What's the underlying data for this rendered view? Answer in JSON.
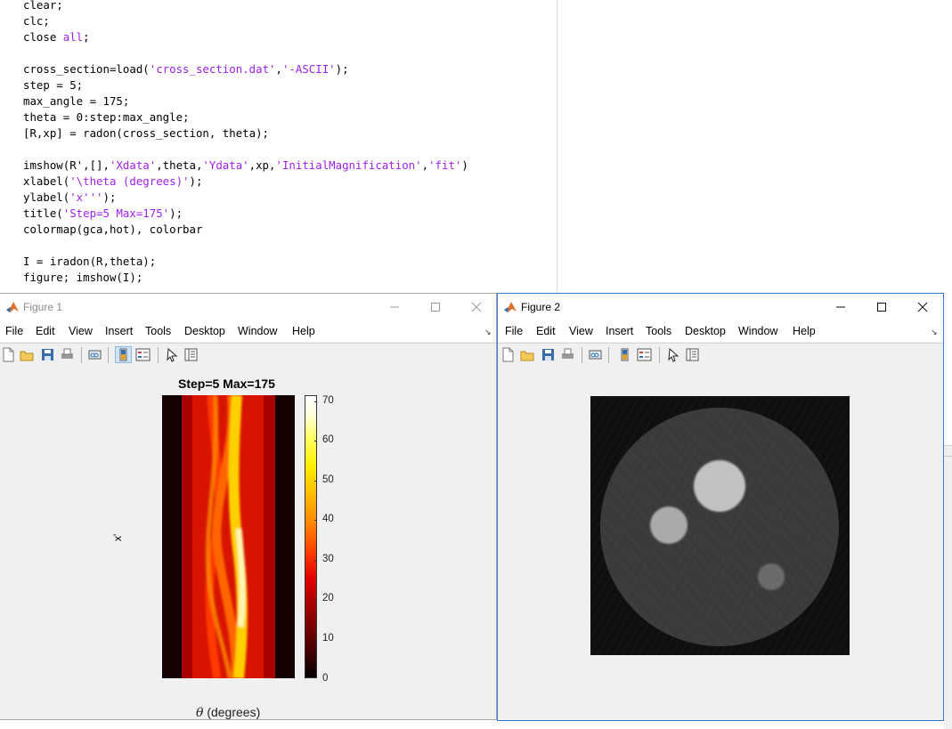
{
  "editor": {
    "lines": [
      {
        "parts": [
          {
            "t": "clear;"
          }
        ]
      },
      {
        "parts": [
          {
            "t": "clc;"
          }
        ]
      },
      {
        "parts": [
          {
            "t": "close "
          },
          {
            "t": "all",
            "s": true
          },
          {
            "t": ";"
          }
        ]
      },
      {
        "parts": [
          {
            "t": ""
          }
        ]
      },
      {
        "parts": [
          {
            "t": "cross_section=load("
          },
          {
            "t": "'cross_section.dat'",
            "s": true
          },
          {
            "t": ","
          },
          {
            "t": "'-ASCII'",
            "s": true
          },
          {
            "t": ");"
          }
        ]
      },
      {
        "parts": [
          {
            "t": "step = 5;"
          }
        ]
      },
      {
        "parts": [
          {
            "t": "max_angle = 175;"
          }
        ]
      },
      {
        "parts": [
          {
            "t": "theta = 0:step:max_angle;"
          }
        ]
      },
      {
        "parts": [
          {
            "t": "[R,xp] = radon(cross_section, theta);"
          }
        ]
      },
      {
        "parts": [
          {
            "t": ""
          }
        ]
      },
      {
        "parts": [
          {
            "t": "imshow(R',[],"
          },
          {
            "t": "'Xdata'",
            "s": true
          },
          {
            "t": ",theta,"
          },
          {
            "t": "'Ydata'",
            "s": true
          },
          {
            "t": ",xp,"
          },
          {
            "t": "'InitialMagnification'",
            "s": true
          },
          {
            "t": ","
          },
          {
            "t": "'fit'",
            "s": true
          },
          {
            "t": ")"
          }
        ]
      },
      {
        "parts": [
          {
            "t": "xlabel("
          },
          {
            "t": "'\\theta (degrees)'",
            "s": true
          },
          {
            "t": ");"
          }
        ]
      },
      {
        "parts": [
          {
            "t": "ylabel("
          },
          {
            "t": "'x'''",
            "s": true
          },
          {
            "t": ");"
          }
        ]
      },
      {
        "parts": [
          {
            "t": "title("
          },
          {
            "t": "'Step=5 Max=175'",
            "s": true
          },
          {
            "t": ");"
          }
        ]
      },
      {
        "parts": [
          {
            "t": "colormap(gca,hot), colorbar"
          }
        ]
      },
      {
        "parts": [
          {
            "t": ""
          }
        ]
      },
      {
        "parts": [
          {
            "t": "I = iradon(R,theta);"
          }
        ]
      },
      {
        "parts": [
          {
            "t": "figure; imshow(I);"
          }
        ]
      }
    ],
    "string_color": "#a020f0"
  },
  "figure1": {
    "title": "Figure 1",
    "menu": [
      "File",
      "Edit",
      "View",
      "Insert",
      "Tools",
      "Desktop",
      "Window",
      "Help"
    ],
    "axes_title": "Step=5 Max=175",
    "ylabel": "x'",
    "xlabel_symbol": "θ",
    "xlabel_rest": " (degrees)",
    "colorbar_ticks": [
      "70",
      "60",
      "50",
      "40",
      "30",
      "20",
      "10",
      "0"
    ],
    "colormap": "hot"
  },
  "figure2": {
    "title": "Figure 2",
    "menu": [
      "File",
      "Edit",
      "View",
      "Insert",
      "Tools",
      "Desktop",
      "Window",
      "Help"
    ]
  }
}
